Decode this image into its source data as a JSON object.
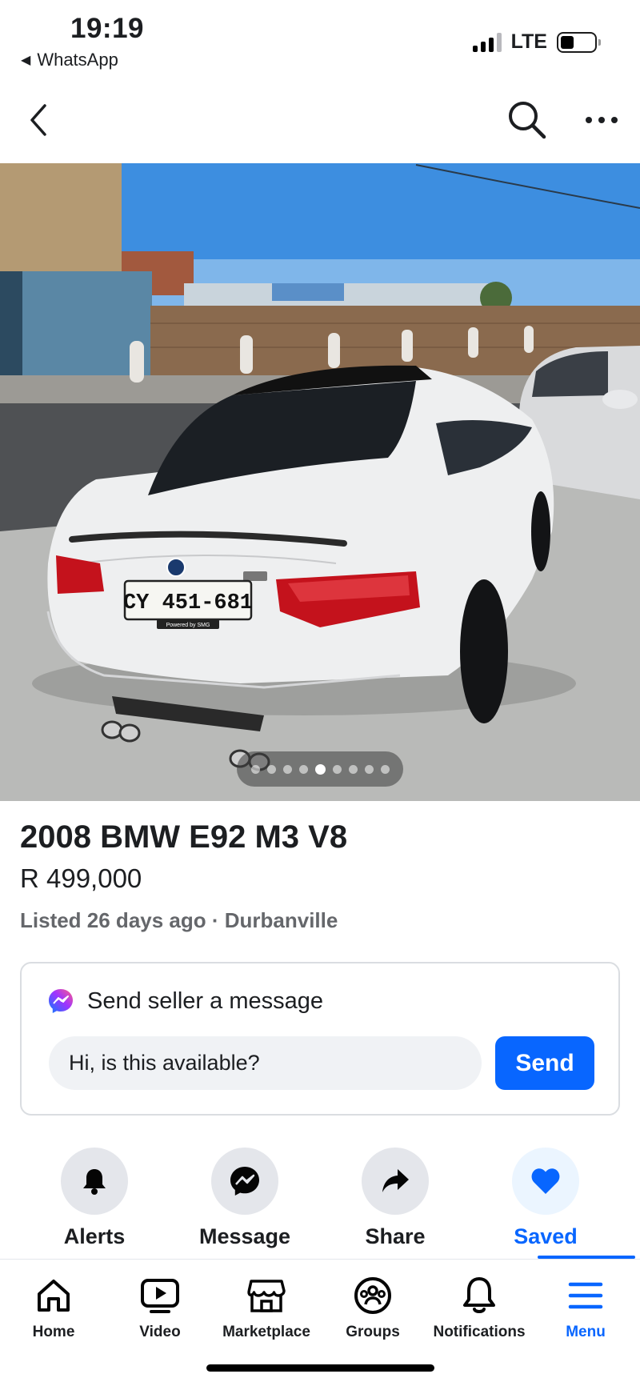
{
  "status_bar": {
    "time": "19:19",
    "back_app": "WhatsApp",
    "network": "LTE",
    "signal_icon": "signal-bars-icon",
    "battery_icon": "battery-icon"
  },
  "nav": {
    "back_icon": "chevron-left-icon",
    "search_icon": "search-icon",
    "more_icon": "more-horizontal-icon"
  },
  "photo": {
    "plate_text": "CY 451-681",
    "plate_sub": "Powered by SMG",
    "carousel_count": 9,
    "carousel_active_index": 4
  },
  "listing": {
    "title": "2008 BMW E92 M3 V8",
    "price": "R 499,000",
    "meta": "Listed 26 days ago · Durbanville"
  },
  "message_card": {
    "heading": "Send seller a message",
    "input_value": "Hi, is this available?",
    "send_label": "Send",
    "icon": "messenger-icon"
  },
  "actions": [
    {
      "label": "Alerts",
      "icon": "bell-icon"
    },
    {
      "label": "Message",
      "icon": "messenger-icon"
    },
    {
      "label": "Share",
      "icon": "share-arrow-icon"
    },
    {
      "label": "Saved",
      "icon": "heart-icon",
      "active": true
    }
  ],
  "tabs": [
    {
      "label": "Home",
      "icon": "home-icon"
    },
    {
      "label": "Video",
      "icon": "video-icon"
    },
    {
      "label": "Marketplace",
      "icon": "marketplace-icon"
    },
    {
      "label": "Groups",
      "icon": "groups-icon"
    },
    {
      "label": "Notifications",
      "icon": "bell-icon"
    },
    {
      "label": "Menu",
      "icon": "menu-icon",
      "active": true
    }
  ],
  "colors": {
    "accent": "#0866ff",
    "secondary_text": "#65676b",
    "button_bg": "#e4e6eb"
  }
}
